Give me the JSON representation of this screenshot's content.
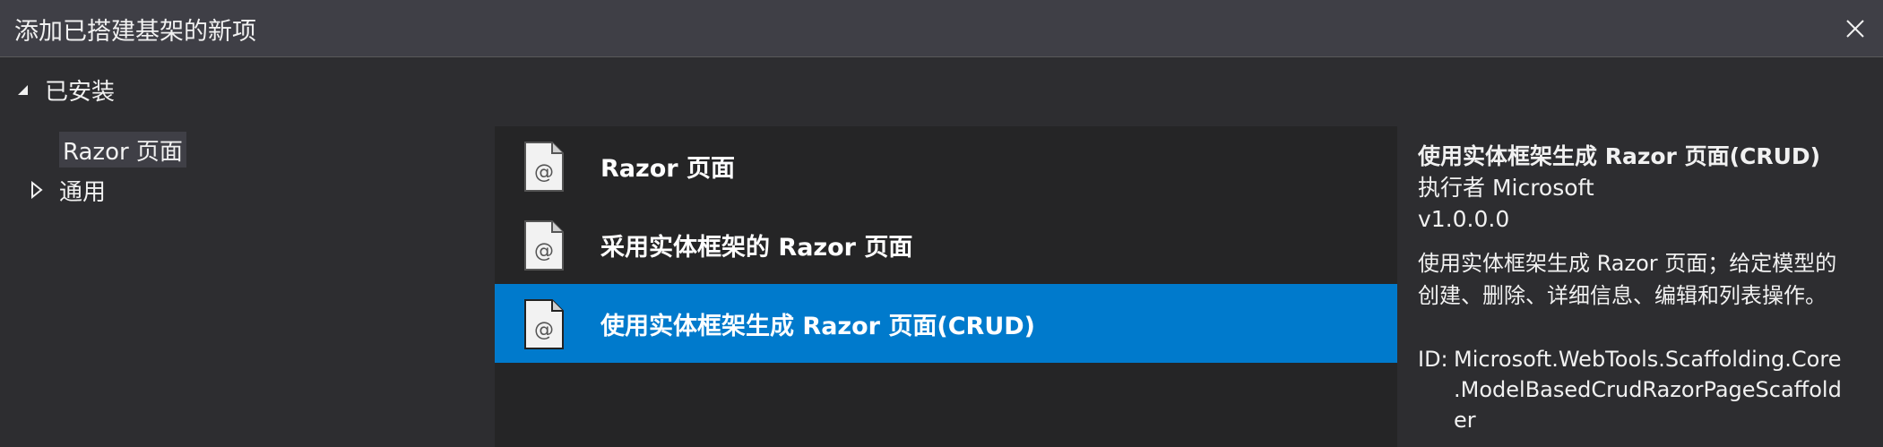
{
  "window": {
    "title": "添加已搭建基架的新项"
  },
  "tree": {
    "root_label": "已安装",
    "items": [
      {
        "label": "Razor 页面",
        "selected": true
      },
      {
        "label": "通用",
        "selected": false
      }
    ]
  },
  "templates": [
    {
      "label": "Razor 页面",
      "selected": false
    },
    {
      "label": "采用实体框架的 Razor 页面",
      "selected": false
    },
    {
      "label": "使用实体框架生成 Razor 页面(CRUD)",
      "selected": true
    }
  ],
  "details": {
    "title": "使用实体框架生成 Razor 页面(CRUD)",
    "author": "执行者 Microsoft",
    "version": "v1.0.0.0",
    "description_line1": "使用实体框架生成 Razor 页面；给定模型的",
    "description_line2": "创建、删除、详细信息、编辑和列表操作。",
    "id_label": "ID:",
    "id_line1": "Microsoft.WebTools.Scaffolding.Core",
    "id_line2": ".ModelBasedCrudRazorPageScaffold",
    "id_line3": "er"
  },
  "icons": {
    "close": "close-icon",
    "expanded": "triangle-expanded-icon",
    "collapsed": "triangle-collapsed-icon",
    "template": "razor-page-file-icon"
  },
  "colors": {
    "background": "#2d2d30",
    "titlebar": "#3f3f46",
    "list_background": "#252526",
    "selection": "#007acc",
    "text": "#f1f1f1"
  }
}
